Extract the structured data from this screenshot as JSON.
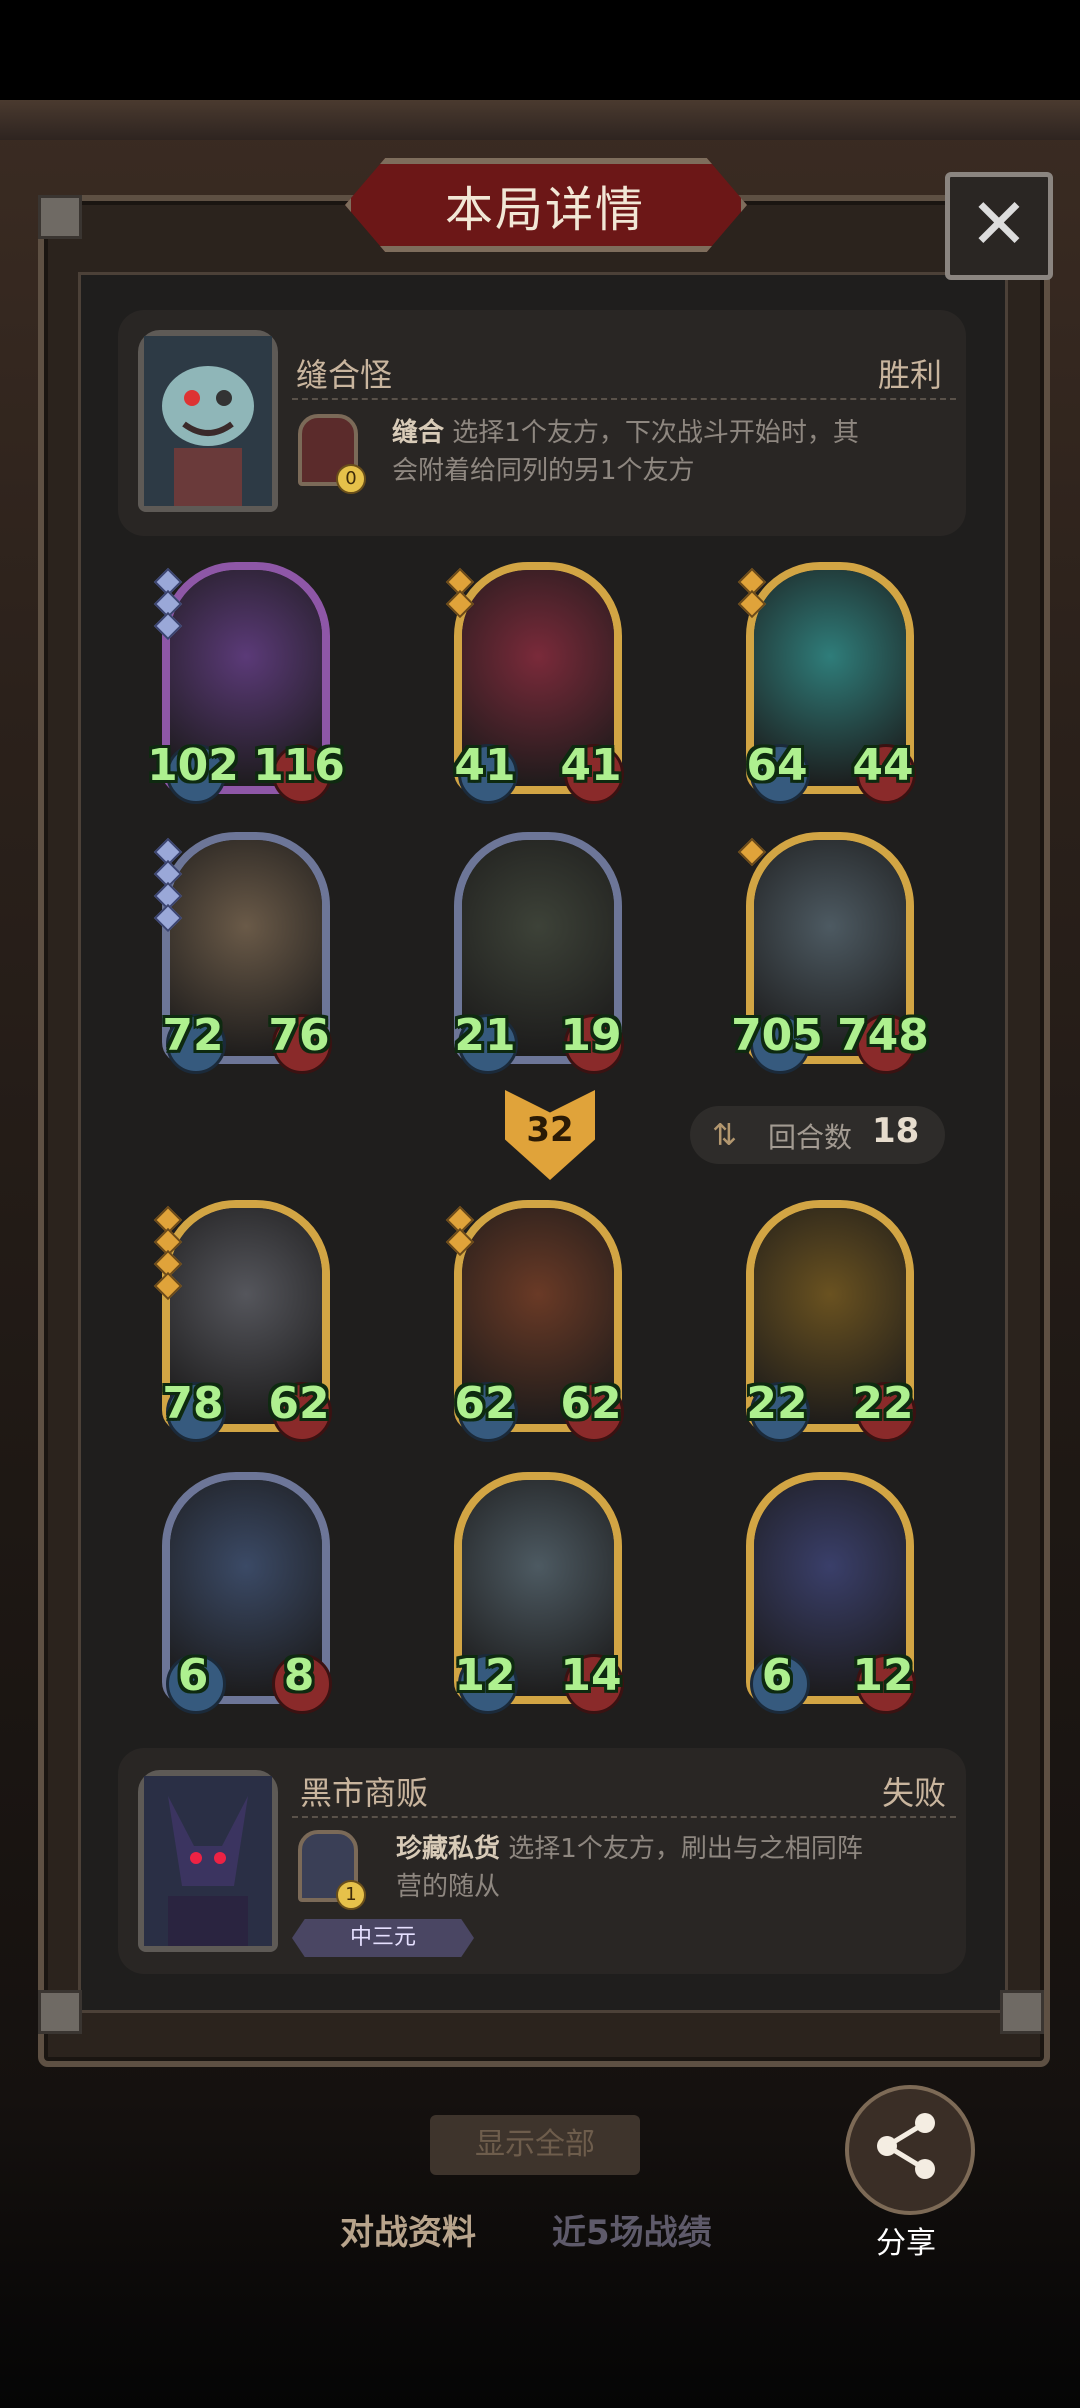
{
  "modal": {
    "title": "本局详情",
    "close_icon": "close-icon"
  },
  "top_player": {
    "name": "缝合怪",
    "result": "胜利",
    "skill": {
      "icon": "stitch-skill-icon",
      "level": "0",
      "name": "缝合",
      "description_line1": "选择1个友方，下次战斗开始时，其",
      "description_line2": "会附着给同列的另1个友方"
    }
  },
  "top_board": [
    {
      "attack": "102",
      "health": "116",
      "tier_gems": 3,
      "gem_color": "blue",
      "frame": "purple",
      "art_color": "#5b3a78"
    },
    {
      "attack": "41",
      "health": "41",
      "tier_gems": 2,
      "gem_color": "gold",
      "frame": "gold",
      "art_color": "#7a2a3a"
    },
    {
      "attack": "64",
      "health": "44",
      "tier_gems": 2,
      "gem_color": "gold",
      "frame": "gold",
      "art_color": "#2f7d7a"
    },
    {
      "attack": "72",
      "health": "76",
      "tier_gems": 4,
      "gem_color": "blue",
      "frame": "silver",
      "art_color": "#6a5a48"
    },
    {
      "attack": "21",
      "health": "19",
      "tier_gems": 0,
      "gem_color": "blue",
      "frame": "silver",
      "art_color": "#3d4238"
    },
    {
      "attack": "705",
      "health": "748",
      "tier_gems": 1,
      "gem_color": "gold",
      "frame": "gold",
      "art_color": "#4d5a62"
    }
  ],
  "round_info": {
    "attack_marker_value": "32",
    "round_icon": "swap-arrows-icon",
    "round_label": "回合数",
    "round_value": "18"
  },
  "bottom_board": [
    {
      "attack": "78",
      "health": "62",
      "tier_gems": 4,
      "gem_color": "gold",
      "frame": "gold",
      "art_color": "#55565c"
    },
    {
      "attack": "62",
      "health": "62",
      "tier_gems": 2,
      "gem_color": "gold",
      "frame": "gold",
      "art_color": "#6a3a26"
    },
    {
      "attack": "22",
      "health": "22",
      "tier_gems": 0,
      "gem_color": "gold",
      "frame": "gold",
      "art_color": "#6a5220"
    },
    {
      "attack": "6",
      "health": "8",
      "tier_gems": 0,
      "gem_color": "blue",
      "frame": "silver",
      "art_color": "#3b4a66"
    },
    {
      "attack": "12",
      "health": "14",
      "tier_gems": 0,
      "gem_color": "gold",
      "frame": "gold",
      "art_color": "#4d5a62"
    },
    {
      "attack": "6",
      "health": "12",
      "tier_gems": 0,
      "gem_color": "gold",
      "frame": "gold",
      "art_color": "#3a3f6a"
    }
  ],
  "bottom_player": {
    "name": "黑市商贩",
    "result": "失败",
    "tier_badge": "中三元",
    "skill": {
      "icon": "helmet-skill-icon",
      "level": "1",
      "name": "珍藏私货",
      "description_line1": "选择1个友方，刷出与之相同阵",
      "description_line2": "营的随从"
    }
  },
  "background": {
    "show_all_button": "显示全部",
    "tabs": [
      "对战资料",
      "近5场战绩"
    ],
    "share_icon": "share-icon",
    "share_label": "分享"
  }
}
